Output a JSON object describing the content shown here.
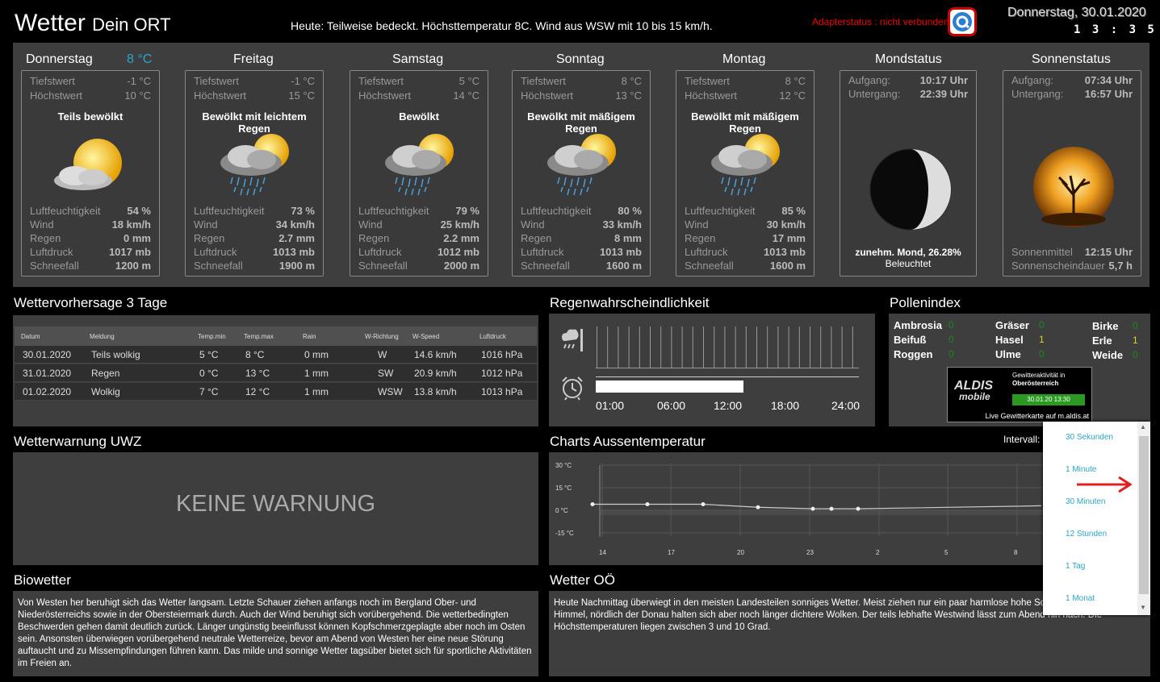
{
  "header": {
    "title": "Wetter",
    "subtitle": "Dein ORT",
    "summary": "Heute: Teilweise bedeckt. Höchsttemperatur 8C. Wind aus WSW mit 10 bis 15 km/h.",
    "adapter_status": "Adapterstatus : nicht verbunden",
    "date": "Donnerstag, 30.01.2020",
    "time": "1 3 : 3 5 : 0 1"
  },
  "labels": {
    "low": "Tiefstwert",
    "high": "Höchstwert",
    "humidity": "Luftfeuchtigkeit",
    "wind": "Wind",
    "rain": "Regen",
    "pressure": "Luftdruck",
    "snowfall": "Schneefall"
  },
  "current_temp": "8 °C",
  "days": [
    {
      "name": "Donnerstag",
      "low": "-1 °C",
      "high": "10 °C",
      "cond": "Teils bewölkt",
      "icon": "partly-cloudy-sun-icon",
      "hum": "54 %",
      "wind": "18 km/h",
      "rain": "0 mm",
      "press": "1017 mb",
      "snow": "1200 m"
    },
    {
      "name": "Freitag",
      "low": "-1 °C",
      "high": "15 °C",
      "cond": "Bewölkt mit leichtem Regen",
      "icon": "rain-cloud-sun-icon",
      "hum": "73 %",
      "wind": "34 km/h",
      "rain": "2.7 mm",
      "press": "1013 mb",
      "snow": "1900 m"
    },
    {
      "name": "Samstag",
      "low": "5 °C",
      "high": "14 °C",
      "cond": "Bewölkt",
      "icon": "rain-cloud-sun-icon",
      "hum": "79 %",
      "wind": "25 km/h",
      "rain": "2.2 mm",
      "press": "1012 mb",
      "snow": "2000 m"
    },
    {
      "name": "Sonntag",
      "low": "8 °C",
      "high": "13 °C",
      "cond": "Bewölkt mit mäßigem Regen",
      "icon": "rain-cloud-sun-icon",
      "hum": "80 %",
      "wind": "33 km/h",
      "rain": "8 mm",
      "press": "1013 mb",
      "snow": "1600 m"
    },
    {
      "name": "Montag",
      "low": "8 °C",
      "high": "12 °C",
      "cond": "Bewölkt mit mäßigem Regen",
      "icon": "rain-cloud-sun-icon",
      "hum": "85 %",
      "wind": "30 km/h",
      "rain": "17 mm",
      "press": "1013 mb",
      "snow": "1600 m"
    }
  ],
  "moon": {
    "title": "Mondstatus",
    "rise_label": "Aufgang:",
    "rise": "10:17 Uhr",
    "set_label": "Untergang:",
    "set": "22:39 Uhr",
    "phase_line1": "zunehm. Mond, 26.28%",
    "phase_line2": "Beleuchtet",
    "icon": "moon-phase-icon"
  },
  "sun": {
    "title": "Sonnenstatus",
    "rise_label": "Aufgang:",
    "rise": "07:34 Uhr",
    "set_label": "Untergang:",
    "set": "16:57 Uhr",
    "noon_label": "Sonnenmittel",
    "noon": "12:15 Uhr",
    "duration_label": "Sonnenscheindauer",
    "duration": "5,7 h",
    "icon": "sun-tree-globe-icon"
  },
  "forecast3": {
    "title": "Wettervorhersage 3 Tage",
    "headers": [
      "Datum",
      "Meldung",
      "Temp.min",
      "Temp.max",
      "Rain",
      "W-Richtung",
      "W-Speed",
      "Luftdruck"
    ],
    "rows": [
      [
        "30.01.2020",
        "Teils wolkig",
        "5 °C",
        "8 °C",
        "0 mm",
        "W",
        "14.6 km/h",
        "1016 hPa"
      ],
      [
        "31.01.2020",
        "Regen",
        "0 °C",
        "13 °C",
        "1 mm",
        "SW",
        "20.9 km/h",
        "1012 hPa"
      ],
      [
        "01.02.2020",
        "Wolkig",
        "7 °C",
        "12 °C",
        "1 mm",
        "WSW",
        "13.8 km/h",
        "1013 hPa"
      ]
    ]
  },
  "rain_prob": {
    "title": "Regenwahrscheindlichkeit",
    "times": [
      "01:00",
      "06:00",
      "12:00",
      "18:00",
      "24:00"
    ],
    "progress": 0.56
  },
  "pollen": {
    "title": "Pollenindex",
    "items": [
      {
        "name": "Ambrosia",
        "value": "0"
      },
      {
        "name": "Gräser",
        "value": "0"
      },
      {
        "name": "Birke",
        "value": "0"
      },
      {
        "name": "Beifuß",
        "value": "0"
      },
      {
        "name": "Hasel",
        "value": "1"
      },
      {
        "name": "Erle",
        "value": "1"
      },
      {
        "name": "Roggen",
        "value": "0"
      },
      {
        "name": "Ulme",
        "value": "0"
      },
      {
        "name": "Weide",
        "value": "0"
      }
    ],
    "ad": {
      "brand": "ALDIS",
      "brand2": "mobile",
      "line1": "Gewitteraktivität in",
      "line2": "Oberösterreich",
      "stamp": "30.01.20 13:30",
      "footer": "Live Gewitterkarte auf m.aldis.at"
    }
  },
  "uwz": {
    "title": "Wetterwarnung UWZ",
    "message": "KEINE WARNUNG"
  },
  "chart": {
    "title": "Charts Aussentemperatur",
    "interval_label": "Intervall:"
  },
  "chart_data": {
    "type": "line",
    "title": "",
    "y_ticks": [
      "30 °C",
      "15 °C",
      "0 °C",
      "-15 °C"
    ],
    "x_ticks": [
      "14",
      "17",
      "20",
      "23",
      "2",
      "5",
      "8"
    ],
    "ylim": [
      -15,
      30
    ],
    "series": [
      {
        "values": [
          4,
          4,
          4,
          2,
          1,
          1,
          1,
          3
        ]
      }
    ]
  },
  "interval_options": [
    "30 Sekunden",
    "1 Minute",
    "30 Minuten",
    "12 Stunden",
    "1 Tag",
    "1 Monat"
  ],
  "bio": {
    "title": "Biowetter",
    "text": "Von Westen her beruhigt sich das Wetter langsam. Letzte Schauer ziehen anfangs noch im Bergland Ober- und Niederösterreichs sowie in der Obersteiermark durch. Auch der Wind beruhigt sich vorübergehend. Die wetterbedingten Beschwerden gehen damit deutlich zurück. Länger ungünstig beeinflusst können Kopfschmerzgeplagte aber noch im Osten sein. Ansonsten überwiegen vorübergehend neutrale Wetterreize, bevor am Abend von Westen her eine neue Störung auftaucht und zu Missempfindungen führen kann. Das milde und sonnige Wetter tagsüber bietet sich für sportliche Aktivitäten im Freien an."
  },
  "ooe": {
    "title": "Wetter OÖ",
    "text": "Heute Nachmittag überwiegt in den meisten Landesteilen sonniges Wetter. Meist ziehen nur ein paar harmlose hohe Schleierwolken über den Himmel, nördlich der Donau halten sich aber noch länger dichtere Wolken. Der teils lebhafte Westwind lässt zum Abend hin nach. Die Höchsttemperaturen liegen zwischen 3 und 10 Grad."
  },
  "colors": {
    "accent": "#2aa6c8",
    "panel": "#3e3e3e",
    "warn": "#e00000"
  }
}
